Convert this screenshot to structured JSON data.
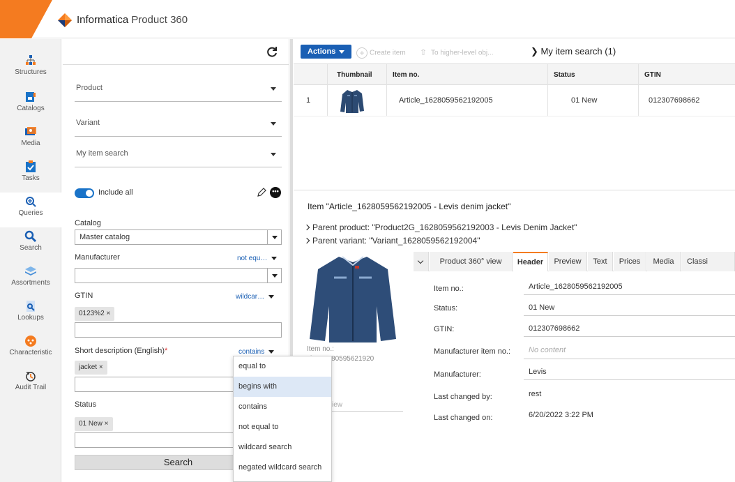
{
  "app": {
    "brand": "Informatica",
    "product": "Product 360",
    "accent": "#f47b20",
    "primary": "#1a5fb4"
  },
  "sidenav": {
    "items": [
      {
        "label": "Structures",
        "icon": "structures-icon"
      },
      {
        "label": "Catalogs",
        "icon": "catalogs-icon"
      },
      {
        "label": "Media",
        "icon": "media-icon"
      },
      {
        "label": "Tasks",
        "icon": "tasks-icon"
      },
      {
        "label": "Queries",
        "icon": "queries-icon"
      },
      {
        "label": "Search",
        "icon": "search-icon"
      },
      {
        "label": "Assortments",
        "icon": "assortments-icon"
      },
      {
        "label": "Lookups",
        "icon": "lookups-icon"
      },
      {
        "label": "Characteristic",
        "icon": "characteristic-icon"
      },
      {
        "label": "Audit Trail",
        "icon": "audit-trail-icon"
      }
    ],
    "active_index": 4
  },
  "left": {
    "dropdowns": [
      "Product",
      "Variant",
      "My item search"
    ],
    "include_all": "Include all",
    "more_label": "•••",
    "fields": {
      "catalog": {
        "label": "Catalog",
        "value": "Master catalog"
      },
      "manufacturer": {
        "label": "Manufacturer",
        "operator": "not equ…",
        "value": ""
      },
      "gtin": {
        "label": "GTIN",
        "operator": "wildcar…",
        "chip": "0123%2 ×"
      },
      "short_desc": {
        "label": "Short description (English)",
        "required": "*",
        "operator": "contains",
        "chip": "jacket ×"
      },
      "status": {
        "label": "Status",
        "chip": "01 New ×"
      }
    },
    "search_button": "Search"
  },
  "operator_menu": {
    "options": [
      "equal to",
      "begins with",
      "contains",
      "not equal to",
      "wildcard search",
      "negated wildcard search"
    ],
    "highlighted_index": 1
  },
  "toolbar": {
    "actions": "Actions",
    "create_item": "Create item",
    "to_higher": "To higher-level obj...",
    "breadcrumb": "My item search (1)"
  },
  "grid": {
    "columns": [
      "Thumbnail",
      "Item no.",
      "Status",
      "GTIN"
    ],
    "rows": [
      {
        "index": "1",
        "item_no": "Article_1628059562192005",
        "status": "01 New",
        "gtin": "012307698662"
      }
    ]
  },
  "detail": {
    "title": "Item \"Article_1628059562192005 - Levis denim jacket\"",
    "parent_product": "Parent product: \"Product2G_1628059562192003 - Levis Denim Jacket\"",
    "parent_variant": "Parent variant: \"Variant_1628059562192004\"",
    "image_item_no_label": "Item no.:",
    "image_item_no_value": "cle_16280595621920",
    "image_faded": "iew",
    "tabs": [
      "Product 360° view",
      "Header",
      "Preview",
      "Text",
      "Prices",
      "Media",
      "Classi"
    ],
    "active_tab_index": 1,
    "fields": [
      {
        "label": "Item no.:",
        "value": "Article_1628059562192005"
      },
      {
        "label": "Status:",
        "value": "01 New"
      },
      {
        "label": "GTIN:",
        "value": "012307698662"
      },
      {
        "label": "Manufacturer item no.:",
        "value": "No content"
      },
      {
        "label": "Manufacturer:",
        "value": "Levis"
      },
      {
        "label": "Last changed by:",
        "value": "rest"
      },
      {
        "label": "Last changed on:",
        "value": "6/20/2022 3:22 PM"
      }
    ]
  }
}
